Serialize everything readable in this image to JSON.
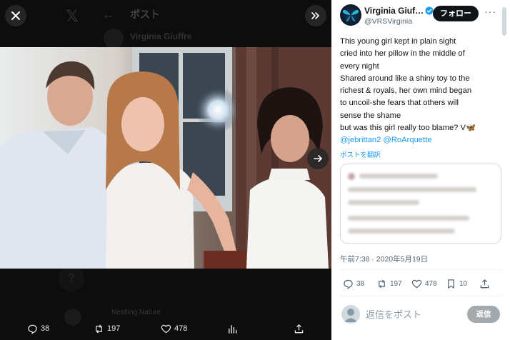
{
  "viewer": {
    "background_title": "ポスト",
    "background_name": "Virginia Giuffre",
    "background_reply_name": "Nestling Nature",
    "actions": {
      "reply_count": "38",
      "repost_count": "197",
      "like_count": "478"
    }
  },
  "tweet": {
    "display_name": "Virginia Giuf…",
    "handle": "@VRSVirginia",
    "follow_label": "フォロー",
    "more_label": "···",
    "text_lines": [
      "This young girl kept in plain sight",
      "cried into her pillow in the middle of",
      "every night",
      "Shared around like a shiny toy to the",
      "richest & royals, her own mind began",
      "to uncoil-she fears that others will",
      "sense the shame",
      "but was this girl really too blame? V🦋"
    ],
    "mention_1": "@jebrittan2",
    "mention_2": "@RoArquette",
    "translate_label": "ポストを翻訳",
    "timestamp": "午前7:38 · 2020年5月19日",
    "stats": {
      "replies": "38",
      "reposts": "197",
      "likes": "478",
      "bookmarks": "10"
    },
    "reply_placeholder": "返信をポスト",
    "reply_button": "返信"
  },
  "colors": {
    "accent": "#1d9bf0",
    "text": "#0f1419",
    "muted": "#536471",
    "follow_bg": "#0f1419",
    "reply_btn_bg": "#a3a9ad"
  },
  "icons": [
    "close-icon",
    "collapse-icon",
    "next-arrow-icon",
    "reply-icon",
    "repost-icon",
    "like-icon",
    "analytics-icon",
    "share-icon",
    "bookmark-icon",
    "verified-icon"
  ]
}
